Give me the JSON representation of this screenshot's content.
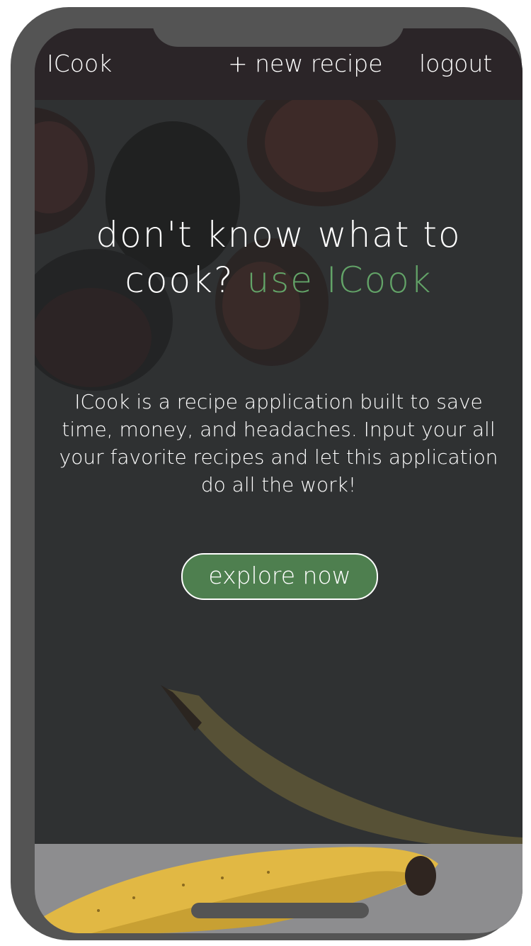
{
  "nav": {
    "brand": "ICook",
    "new_recipe": "+ new recipe",
    "logout": "logout"
  },
  "hero": {
    "headline_line1": "don't know what to",
    "headline_line2_prefix": "cook?",
    "headline_line2_accent": "use ICook",
    "description": "ICook is a recipe application built to save time, money, and headaches. Input your all your favorite recipes and let this application do all the work!",
    "cta_label": "explore now"
  },
  "colors": {
    "navbar": "#2b2528",
    "hero_overlay": "#2f3132",
    "accent": "#63a468",
    "button": "#4e7f4f",
    "frame": "#545454"
  },
  "icons": {
    "figs": "figs-image",
    "banana": "banana-image"
  }
}
